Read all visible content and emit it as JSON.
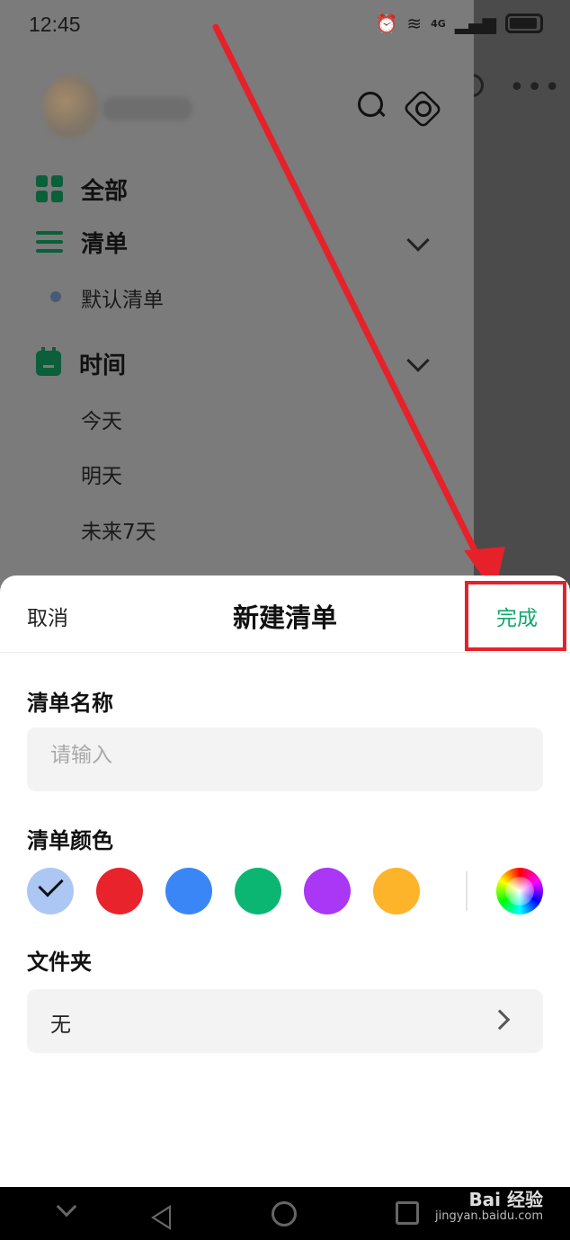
{
  "status_bar": {
    "time": "12:45",
    "network": "4G"
  },
  "drawer": {
    "all_label": "全部",
    "lists_label": "清单",
    "default_list_label": "默认清单",
    "time_label": "时间",
    "today_label": "今天",
    "tomorrow_label": "明天",
    "next7_label": "未来7天"
  },
  "sheet": {
    "cancel_label": "取消",
    "title": "新建清单",
    "done_label": "完成",
    "name_label": "清单名称",
    "name_placeholder": "请输入",
    "name_value": "",
    "color_label": "清单颜色",
    "colors": [
      "#adc7f5",
      "#e8232b",
      "#3b86f7",
      "#0bb673",
      "#a937f5",
      "#fdb32a"
    ],
    "selected_color_index": 0,
    "folder_label": "文件夹",
    "folder_value": "无"
  },
  "annotation": {
    "arrow_color": "#e6212a"
  },
  "watermark": {
    "brand": "Bai 经验",
    "url": "jingyan.baidu.com"
  }
}
